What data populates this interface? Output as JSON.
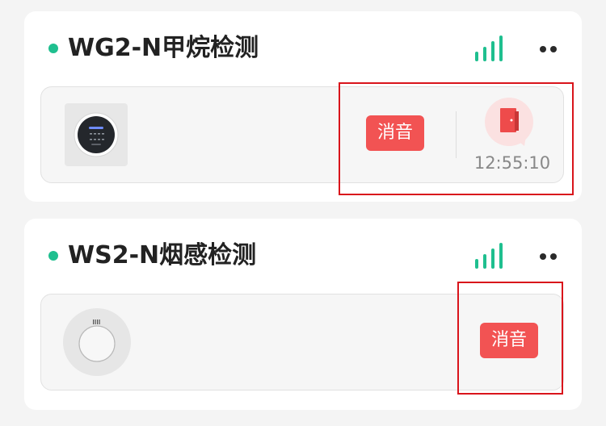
{
  "devices": [
    {
      "title": "WG2-N甲烷检测",
      "mute_label": "消音",
      "time": "12:55:10",
      "device_icon": "gas-detector-icon",
      "event_icon": "door-icon"
    },
    {
      "title": "WS2-N烟感检测",
      "mute_label": "消音",
      "device_icon": "smoke-detector-icon"
    }
  ],
  "colors": {
    "online_dot": "#1fbf8f",
    "signal": "#1fbf8f",
    "mute_button": "#f25353",
    "door_badge": "#ee4b4b",
    "highlight": "#d9141b"
  }
}
